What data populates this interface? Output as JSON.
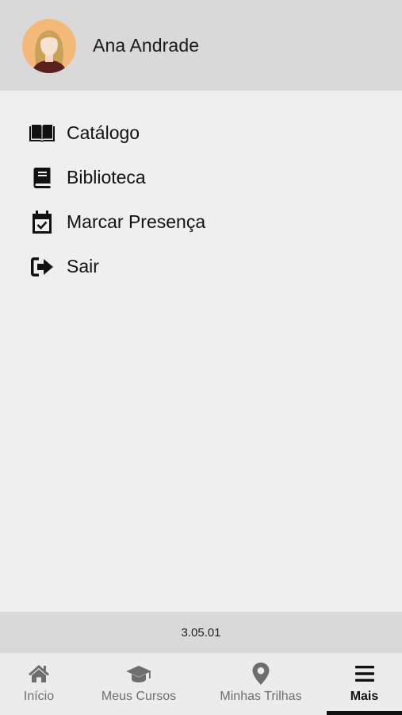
{
  "user": {
    "name": "Ana Andrade"
  },
  "menu": {
    "items": [
      {
        "label": "Catálogo",
        "icon": "open-book-icon"
      },
      {
        "label": "Biblioteca",
        "icon": "book-icon"
      },
      {
        "label": "Marcar Presença",
        "icon": "calendar-check-icon"
      },
      {
        "label": "Sair",
        "icon": "sign-out-icon"
      }
    ]
  },
  "footer": {
    "version": "3.05.01"
  },
  "tabs": [
    {
      "label": "Início",
      "icon": "home-icon",
      "active": false
    },
    {
      "label": "Meus Cursos",
      "icon": "graduation-cap-icon",
      "active": false
    },
    {
      "label": "Minhas Trilhas",
      "icon": "map-pin-icon",
      "active": false
    },
    {
      "label": "Mais",
      "icon": "hamburger-menu-icon",
      "active": true
    }
  ],
  "colors": {
    "header_bg": "#d9d9d9",
    "page_bg": "#efefef",
    "active_tab": "#111111",
    "inactive_tab": "#6e6e6e",
    "avatar_bg": "#f4b878"
  }
}
